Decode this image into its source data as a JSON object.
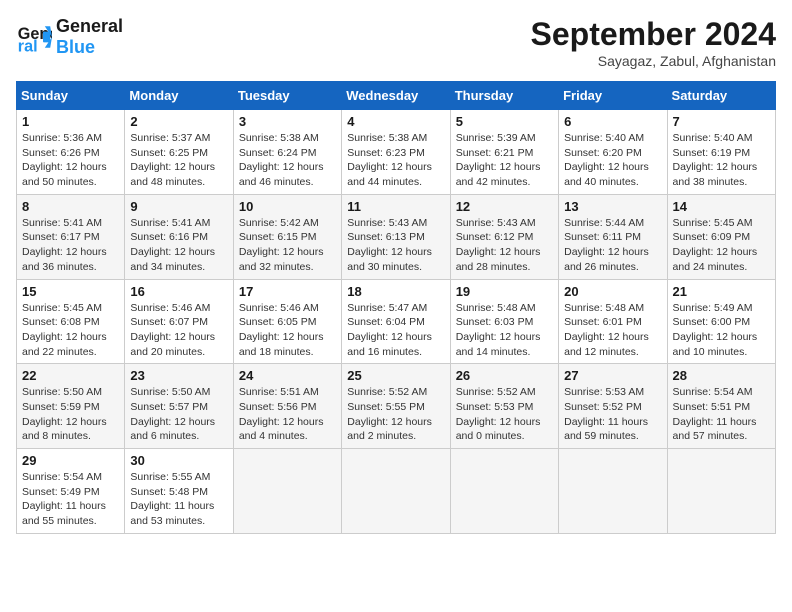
{
  "header": {
    "logo_line1": "General",
    "logo_line2": "Blue",
    "month_title": "September 2024",
    "location": "Sayagaz, Zabul, Afghanistan"
  },
  "weekdays": [
    "Sunday",
    "Monday",
    "Tuesday",
    "Wednesday",
    "Thursday",
    "Friday",
    "Saturday"
  ],
  "weeks": [
    [
      {
        "day": "1",
        "info": "Sunrise: 5:36 AM\nSunset: 6:26 PM\nDaylight: 12 hours\nand 50 minutes."
      },
      {
        "day": "2",
        "info": "Sunrise: 5:37 AM\nSunset: 6:25 PM\nDaylight: 12 hours\nand 48 minutes."
      },
      {
        "day": "3",
        "info": "Sunrise: 5:38 AM\nSunset: 6:24 PM\nDaylight: 12 hours\nand 46 minutes."
      },
      {
        "day": "4",
        "info": "Sunrise: 5:38 AM\nSunset: 6:23 PM\nDaylight: 12 hours\nand 44 minutes."
      },
      {
        "day": "5",
        "info": "Sunrise: 5:39 AM\nSunset: 6:21 PM\nDaylight: 12 hours\nand 42 minutes."
      },
      {
        "day": "6",
        "info": "Sunrise: 5:40 AM\nSunset: 6:20 PM\nDaylight: 12 hours\nand 40 minutes."
      },
      {
        "day": "7",
        "info": "Sunrise: 5:40 AM\nSunset: 6:19 PM\nDaylight: 12 hours\nand 38 minutes."
      }
    ],
    [
      {
        "day": "8",
        "info": "Sunrise: 5:41 AM\nSunset: 6:17 PM\nDaylight: 12 hours\nand 36 minutes."
      },
      {
        "day": "9",
        "info": "Sunrise: 5:41 AM\nSunset: 6:16 PM\nDaylight: 12 hours\nand 34 minutes."
      },
      {
        "day": "10",
        "info": "Sunrise: 5:42 AM\nSunset: 6:15 PM\nDaylight: 12 hours\nand 32 minutes."
      },
      {
        "day": "11",
        "info": "Sunrise: 5:43 AM\nSunset: 6:13 PM\nDaylight: 12 hours\nand 30 minutes."
      },
      {
        "day": "12",
        "info": "Sunrise: 5:43 AM\nSunset: 6:12 PM\nDaylight: 12 hours\nand 28 minutes."
      },
      {
        "day": "13",
        "info": "Sunrise: 5:44 AM\nSunset: 6:11 PM\nDaylight: 12 hours\nand 26 minutes."
      },
      {
        "day": "14",
        "info": "Sunrise: 5:45 AM\nSunset: 6:09 PM\nDaylight: 12 hours\nand 24 minutes."
      }
    ],
    [
      {
        "day": "15",
        "info": "Sunrise: 5:45 AM\nSunset: 6:08 PM\nDaylight: 12 hours\nand 22 minutes."
      },
      {
        "day": "16",
        "info": "Sunrise: 5:46 AM\nSunset: 6:07 PM\nDaylight: 12 hours\nand 20 minutes."
      },
      {
        "day": "17",
        "info": "Sunrise: 5:46 AM\nSunset: 6:05 PM\nDaylight: 12 hours\nand 18 minutes."
      },
      {
        "day": "18",
        "info": "Sunrise: 5:47 AM\nSunset: 6:04 PM\nDaylight: 12 hours\nand 16 minutes."
      },
      {
        "day": "19",
        "info": "Sunrise: 5:48 AM\nSunset: 6:03 PM\nDaylight: 12 hours\nand 14 minutes."
      },
      {
        "day": "20",
        "info": "Sunrise: 5:48 AM\nSunset: 6:01 PM\nDaylight: 12 hours\nand 12 minutes."
      },
      {
        "day": "21",
        "info": "Sunrise: 5:49 AM\nSunset: 6:00 PM\nDaylight: 12 hours\nand 10 minutes."
      }
    ],
    [
      {
        "day": "22",
        "info": "Sunrise: 5:50 AM\nSunset: 5:59 PM\nDaylight: 12 hours\nand 8 minutes."
      },
      {
        "day": "23",
        "info": "Sunrise: 5:50 AM\nSunset: 5:57 PM\nDaylight: 12 hours\nand 6 minutes."
      },
      {
        "day": "24",
        "info": "Sunrise: 5:51 AM\nSunset: 5:56 PM\nDaylight: 12 hours\nand 4 minutes."
      },
      {
        "day": "25",
        "info": "Sunrise: 5:52 AM\nSunset: 5:55 PM\nDaylight: 12 hours\nand 2 minutes."
      },
      {
        "day": "26",
        "info": "Sunrise: 5:52 AM\nSunset: 5:53 PM\nDaylight: 12 hours\nand 0 minutes."
      },
      {
        "day": "27",
        "info": "Sunrise: 5:53 AM\nSunset: 5:52 PM\nDaylight: 11 hours\nand 59 minutes."
      },
      {
        "day": "28",
        "info": "Sunrise: 5:54 AM\nSunset: 5:51 PM\nDaylight: 11 hours\nand 57 minutes."
      }
    ],
    [
      {
        "day": "29",
        "info": "Sunrise: 5:54 AM\nSunset: 5:49 PM\nDaylight: 11 hours\nand 55 minutes."
      },
      {
        "day": "30",
        "info": "Sunrise: 5:55 AM\nSunset: 5:48 PM\nDaylight: 11 hours\nand 53 minutes."
      },
      {
        "day": "",
        "info": ""
      },
      {
        "day": "",
        "info": ""
      },
      {
        "day": "",
        "info": ""
      },
      {
        "day": "",
        "info": ""
      },
      {
        "day": "",
        "info": ""
      }
    ]
  ]
}
